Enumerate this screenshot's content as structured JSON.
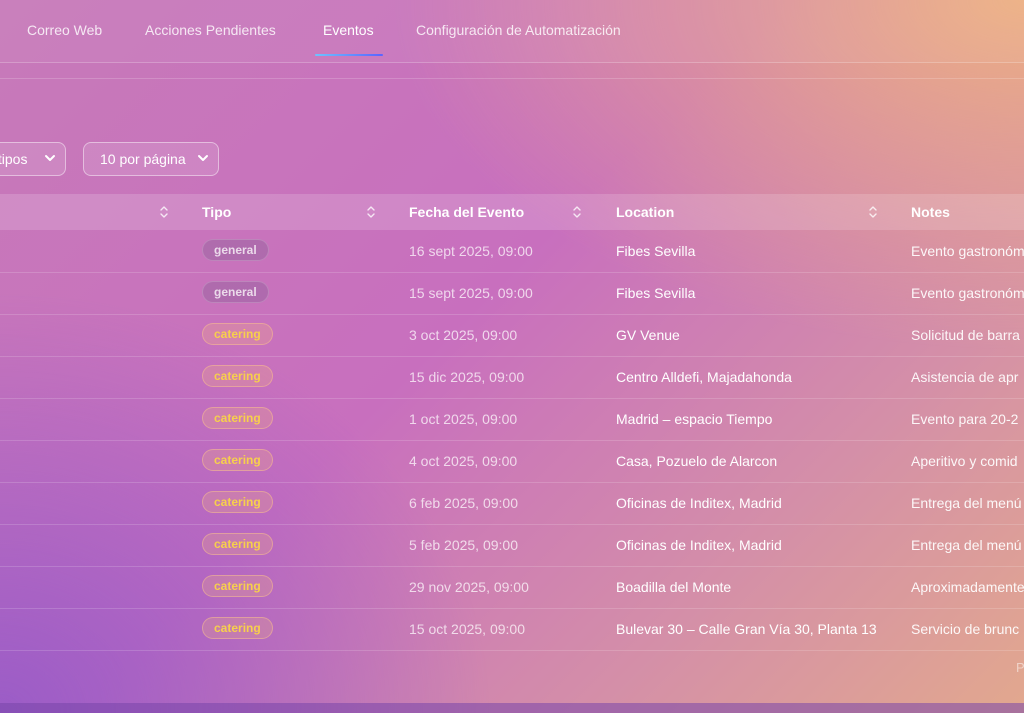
{
  "nav": {
    "tabs": [
      {
        "label": "Correo Web"
      },
      {
        "label": "Acciones Pendientes"
      },
      {
        "label": "Eventos"
      },
      {
        "label": "Configuración de Automatización"
      }
    ],
    "active_tab": "Eventos"
  },
  "filters": {
    "type_select": "s tipos",
    "per_page_select": "10 por página"
  },
  "table": {
    "headers": {
      "type": "Tipo",
      "date": "Fecha del Evento",
      "location": "Location",
      "notes": "Notes"
    },
    "rows": [
      {
        "type": "general",
        "date": "16 sept 2025, 09:00",
        "location": "Fibes Sevilla",
        "notes": "Evento gastronóm"
      },
      {
        "type": "general",
        "date": "15 sept 2025, 09:00",
        "location": "Fibes Sevilla",
        "notes": "Evento gastronóm"
      },
      {
        "type": "catering",
        "date": "3 oct 2025, 09:00",
        "location": "GV Venue",
        "notes": "Solicitud de barra"
      },
      {
        "type": "catering",
        "date": "15 dic 2025, 09:00",
        "location": "Centro Alldefi, Majadahonda",
        "notes": "Asistencia de apr"
      },
      {
        "type": "catering",
        "date": "1 oct 2025, 09:00",
        "location": "Madrid – espacio Tiempo",
        "notes": "Evento para 20-2"
      },
      {
        "type": "catering",
        "date": "4 oct 2025, 09:00",
        "location": "Casa, Pozuelo de Alarcon",
        "notes": "Aperitivo y comid"
      },
      {
        "type": "catering",
        "date": "6 feb 2025, 09:00",
        "location": "Oficinas de Inditex, Madrid",
        "notes": "Entrega del menú"
      },
      {
        "type": "catering",
        "date": "5 feb 2025, 09:00",
        "location": "Oficinas de Inditex, Madrid",
        "notes": "Entrega del menú"
      },
      {
        "type": "catering",
        "date": "29 nov 2025, 09:00",
        "location": "Boadilla del Monte",
        "notes": "Aproximadamente"
      },
      {
        "type": "catering",
        "date": "15 oct 2025, 09:00",
        "location": "Bulevar 30 – Calle Gran Vía 30, Planta 13",
        "notes": "Servicio de brunc"
      }
    ]
  },
  "pager_hint": "P",
  "colors": {
    "accent_underline_start": "#6ec3ff",
    "accent_underline_end": "#5b63ff",
    "catering_badge_text": "#f7d04b"
  },
  "icons": {
    "sort": "sort-arrows-icon",
    "select": "chevron-down-icon"
  }
}
